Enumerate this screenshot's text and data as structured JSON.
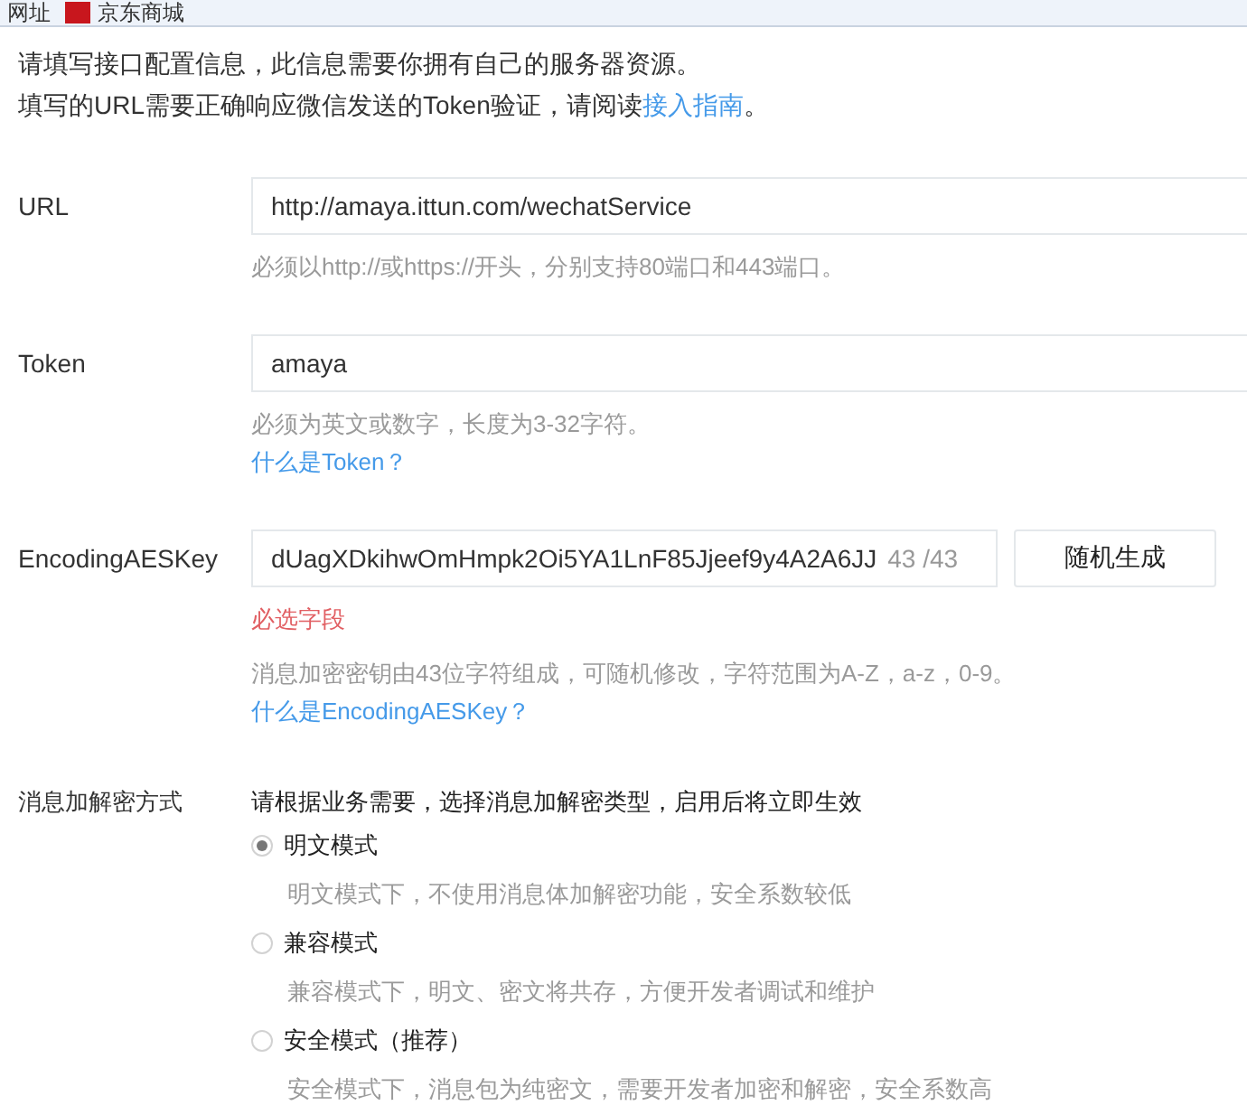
{
  "bookmarks_bar": {
    "items": [
      {
        "kind": "text",
        "label": "网址"
      },
      {
        "kind": "logo",
        "label": "京东商城"
      }
    ]
  },
  "intro": {
    "line_1": "请填写接口配置信息，此信息需要你拥有自己的服务器资源。",
    "line_2_before": "填写的URL需要正确响应微信发送的Token验证，请阅读",
    "line_2_link": "接入指南",
    "line_2_after": "。"
  },
  "fields": [
    {
      "label": "URL",
      "value": "http://amaya.ittun.com/wechatService",
      "notes": [
        {
          "kind": "hint",
          "text": "必须以http://或https://开头，分别支持80端口和443端口。"
        }
      ]
    },
    {
      "label": "Token",
      "value": "amaya",
      "notes": [
        {
          "kind": "hint",
          "text": "必须为英文或数字，长度为3-32字符。"
        },
        {
          "kind": "link",
          "text": "什么是Token？"
        }
      ]
    },
    {
      "label": "EncodingAESKey",
      "value": "dUagXDkihwOmHmpk2Oi5YA1LnF85Jjeef9y4A2A6JJ",
      "counter": "43 /43",
      "button": "随机生成",
      "notes": [
        {
          "kind": "error",
          "text": "必选字段"
        },
        {
          "kind": "hint",
          "text": "消息加密密钥由43位字符组成，可随机修改，字符范围为A-Z，a-z，0-9。"
        },
        {
          "kind": "link",
          "text": "什么是EncodingAESKey？"
        }
      ]
    }
  ],
  "encryption_mode": {
    "label": "消息加解密方式",
    "description": "请根据业务需要，选择消息加解密类型，启用后将立即生效",
    "options": [
      {
        "label": "明文模式",
        "description": "明文模式下，不使用消息体加解密功能，安全系数较低",
        "selected": true
      },
      {
        "label": "兼容模式",
        "description": "兼容模式下，明文、密文将共存，方便开发者调试和维护",
        "selected": false
      },
      {
        "label": "安全模式（推荐）",
        "description": "安全模式下，消息包为纯密文，需要开发者加密和解密，安全系数高",
        "selected": false
      }
    ]
  }
}
